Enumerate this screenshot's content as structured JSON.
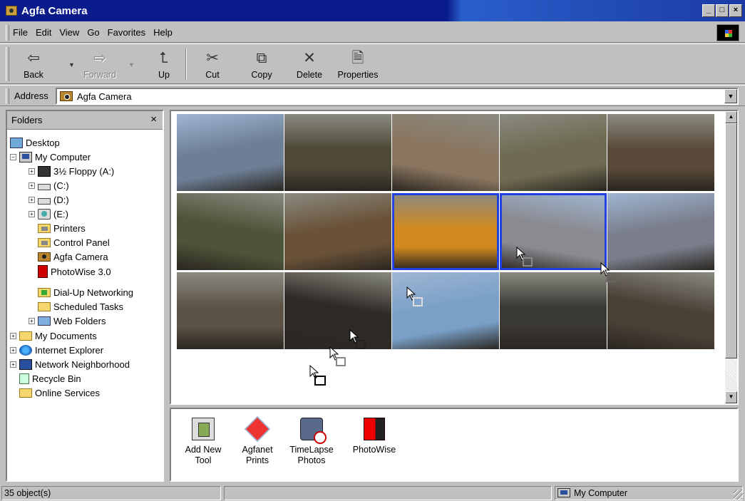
{
  "window": {
    "title": "Agfa Camera",
    "buttons": [
      "_",
      "□",
      "×"
    ]
  },
  "menu": [
    "File",
    "Edit",
    "View",
    "Go",
    "Favorites",
    "Help"
  ],
  "toolbar": {
    "back": "Back",
    "forward": "Forward",
    "up": "Up",
    "cut": "Cut",
    "copy": "Copy",
    "delete": "Delete",
    "properties": "Properties"
  },
  "address": {
    "label": "Address",
    "value": "Agfa Camera"
  },
  "folders": {
    "title": "Folders",
    "close": "×",
    "items": [
      {
        "label": "Desktop",
        "icon": "desktop-icon"
      },
      {
        "label": "My Computer",
        "icon": "computer-icon"
      },
      {
        "label": "3½ Floppy (A:)",
        "icon": "floppy-icon"
      },
      {
        "label": "(C:)",
        "icon": "drive-icon"
      },
      {
        "label": "(D:)",
        "icon": "drive-icon"
      },
      {
        "label": "(E:)",
        "icon": "cd-drive-icon"
      },
      {
        "label": "Printers",
        "icon": "printer-folder-icon"
      },
      {
        "label": "Control Panel",
        "icon": "control-panel-icon"
      },
      {
        "label": "Agfa Camera",
        "icon": "camera-icon"
      },
      {
        "label": "PhotoWise 3.0",
        "icon": "photowise-icon"
      },
      {
        "label": "Dial-Up Networking",
        "icon": "dialup-icon"
      },
      {
        "label": "Scheduled Tasks",
        "icon": "scheduled-tasks-icon"
      },
      {
        "label": "Web Folders",
        "icon": "web-folders-icon"
      },
      {
        "label": "My Documents",
        "icon": "folder-icon"
      },
      {
        "label": "Internet Explorer",
        "icon": "ie-icon"
      },
      {
        "label": "Network Neighborhood",
        "icon": "network-icon"
      },
      {
        "label": "Recycle Bin",
        "icon": "recycle-bin-icon"
      },
      {
        "label": "Online Services",
        "icon": "folder-icon"
      }
    ]
  },
  "thumbnails": {
    "selected": [
      7,
      8
    ],
    "colors": [
      "#6d7f96",
      "#4f4a38",
      "#8a7660",
      "#6f6b52",
      "#5a4a3a",
      "#4e5438",
      "#6a5238",
      "#d08a20",
      "#8a8a90",
      "#7a7e8c",
      "#5c5246",
      "#2e2a26",
      "#7aa0c8",
      "#3a3834",
      "#4a4036"
    ]
  },
  "tools": [
    {
      "label": "Add New\nTool",
      "line1": "Add New",
      "line2": "Tool",
      "icon": "add-tool-icon"
    },
    {
      "label": "Agfanet Prints",
      "line1": "Agfanet",
      "line2": "Prints",
      "icon": "agfanet-icon"
    },
    {
      "label": "TimeLapse Photos",
      "line1": "TimeLapse",
      "line2": "Photos",
      "icon": "timelapse-icon"
    },
    {
      "label": "PhotoWise",
      "line1": "PhotoWise",
      "line2": "",
      "icon": "photowise-icon"
    }
  ],
  "status": {
    "count": "35 object(s)",
    "zone": "My Computer"
  }
}
